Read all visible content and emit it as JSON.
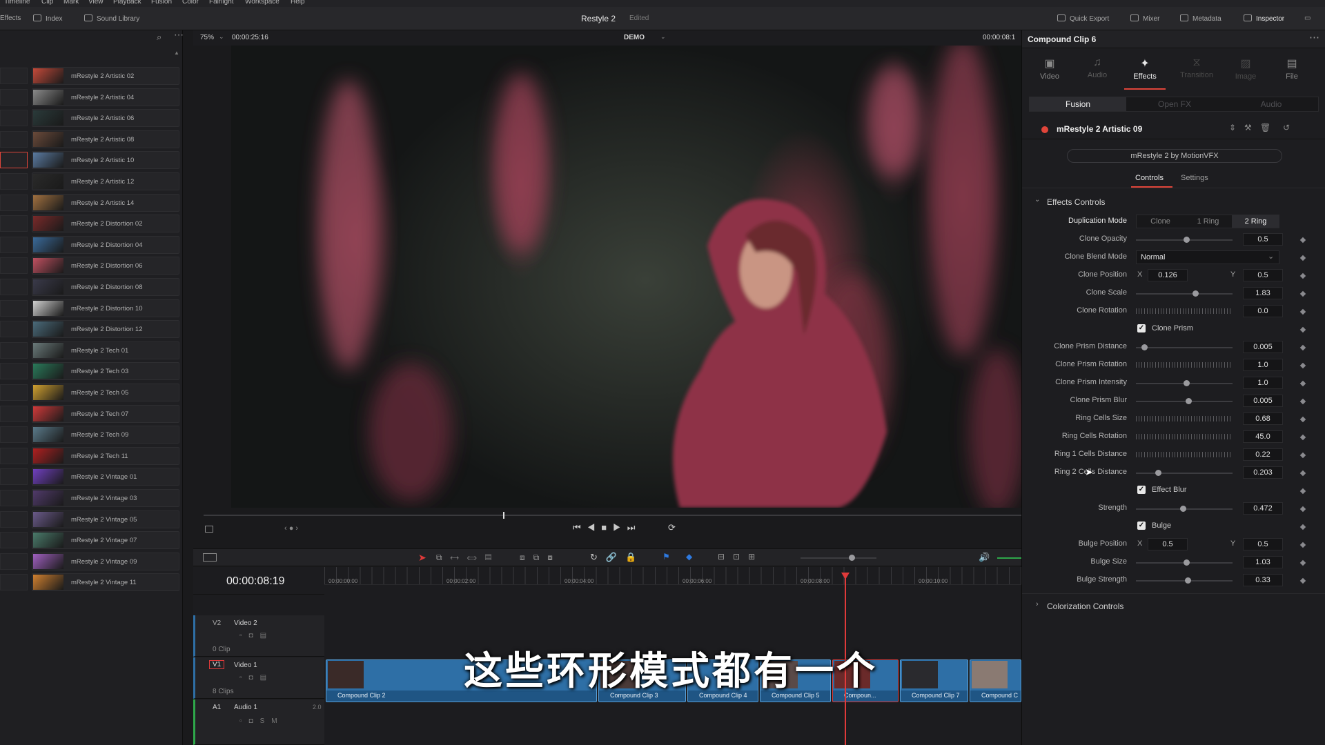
{
  "menu": [
    "Timeline",
    "Clip",
    "Mark",
    "View",
    "Playback",
    "Fusion",
    "Color",
    "Fairlight",
    "Workspace",
    "Help"
  ],
  "toolbar": {
    "effects": "Effects",
    "index": "Index",
    "sound_library": "Sound Library",
    "project_title": "Restyle 2",
    "project_status": "Edited",
    "quick_export": "Quick Export",
    "mixer": "Mixer",
    "metadata": "Metadata",
    "inspector": "Inspector"
  },
  "effects_list": [
    {
      "name": "mRestyle 2 Artistic 02",
      "color": "#c44a3a"
    },
    {
      "name": "mRestyle 2 Artistic 04",
      "color": "#8a8a8a"
    },
    {
      "name": "mRestyle 2 Artistic 06",
      "color": "#2a3a3a"
    },
    {
      "name": "mRestyle 2 Artistic 08",
      "color": "#6a4a3a"
    },
    {
      "name": "mRestyle 2 Artistic 10",
      "color": "#5a7aa0"
    },
    {
      "name": "mRestyle 2 Artistic 12",
      "color": "#2a2a2a"
    },
    {
      "name": "mRestyle 2 Artistic 14",
      "color": "#a07040"
    },
    {
      "name": "mRestyle 2 Distortion 02",
      "color": "#7a2a2a"
    },
    {
      "name": "mRestyle 2 Distortion 04",
      "color": "#3a6a9a"
    },
    {
      "name": "mRestyle 2 Distortion 06",
      "color": "#c05060"
    },
    {
      "name": "mRestyle 2 Distortion 08",
      "color": "#3a3a4a"
    },
    {
      "name": "mRestyle 2 Distortion 10",
      "color": "#d0d0d0"
    },
    {
      "name": "mRestyle 2 Distortion 12",
      "color": "#4a6a7a"
    },
    {
      "name": "mRestyle 2 Tech 01",
      "color": "#6a7a7a"
    },
    {
      "name": "mRestyle 2 Tech 03",
      "color": "#2a7a5a"
    },
    {
      "name": "mRestyle 2 Tech 05",
      "color": "#d0a030"
    },
    {
      "name": "mRestyle 2 Tech 07",
      "color": "#d03a3a"
    },
    {
      "name": "mRestyle 2 Tech 09",
      "color": "#5a7a8a"
    },
    {
      "name": "mRestyle 2 Tech 11",
      "color": "#b02020"
    },
    {
      "name": "mRestyle 2 Vintage 01",
      "color": "#7040c0"
    },
    {
      "name": "mRestyle 2 Vintage 03",
      "color": "#503a6a"
    },
    {
      "name": "mRestyle 2 Vintage 05",
      "color": "#6a5a8a"
    },
    {
      "name": "mRestyle 2 Vintage 07",
      "color": "#4a7a6a"
    },
    {
      "name": "mRestyle 2 Vintage 09",
      "color": "#a060c0"
    },
    {
      "name": "mRestyle 2 Vintage 11",
      "color": "#d08030"
    }
  ],
  "viewer": {
    "zoom": "75%",
    "timecode": "00:00:25:16",
    "clip_name": "DEMO",
    "right_timecode": "00:00:08:1"
  },
  "timeline": {
    "current_timecode": "00:00:08:19",
    "ruler": [
      "00:00:00:00",
      "00:00:02:00",
      "00:00:04:00",
      "00:00:06:00",
      "00:00:08:00",
      "00:00:10:00"
    ],
    "tracks": {
      "v2": {
        "id": "V2",
        "name": "Video 2",
        "count": "0 Clip"
      },
      "v1": {
        "id": "V1",
        "name": "Video 1",
        "count": "8 Clips"
      },
      "a1": {
        "id": "A1",
        "name": "Audio 1",
        "level": "2.0"
      }
    },
    "clips": [
      "Compound Clip 2",
      "Compound Clip 3",
      "Compound Clip 4",
      "Compound Clip 5",
      "Compoun...",
      "Compound Clip 7",
      "Compound C"
    ],
    "subtitle": "这些环形模式都有一个"
  },
  "inspector": {
    "title": "Compound Clip 6",
    "tabs": [
      "Video",
      "Audio",
      "Effects",
      "Transition",
      "Image",
      "File"
    ],
    "subtabs": [
      "Fusion",
      "Open FX",
      "Audio"
    ],
    "effect_name": "mRestyle 2 Artistic 09",
    "plugin_button": "mRestyle 2 by MotionVFX",
    "control_tabs": [
      "Controls",
      "Settings"
    ],
    "section_effects": "Effects Controls",
    "section_colorization": "Colorization Controls",
    "duplication_mode": {
      "label": "Duplication Mode",
      "options": [
        "Clone",
        "1 Ring",
        "2 Ring"
      ]
    },
    "clone_blend_mode": {
      "label": "Clone Blend Mode",
      "value": "Normal"
    },
    "clone_position": {
      "label": "Clone Position",
      "x_label": "X",
      "x": "0.126",
      "y_label": "Y",
      "y": "0.5"
    },
    "bulge_position": {
      "label": "Bulge Position",
      "x_label": "X",
      "x": "0.5",
      "y_label": "Y",
      "y": "0.5"
    },
    "checks": {
      "clone_prism": "Clone Prism",
      "effect_blur": "Effect Blur",
      "bulge": "Bulge"
    },
    "params": {
      "clone_opacity": {
        "label": "Clone Opacity",
        "value": "0.5"
      },
      "clone_scale": {
        "label": "Clone Scale",
        "value": "1.83"
      },
      "clone_rotation": {
        "label": "Clone Rotation",
        "value": "0.0"
      },
      "clone_prism_distance": {
        "label": "Clone Prism Distance",
        "value": "0.005"
      },
      "clone_prism_rotation": {
        "label": "Clone Prism Rotation",
        "value": "1.0"
      },
      "clone_prism_intensity": {
        "label": "Clone Prism Intensity",
        "value": "1.0"
      },
      "clone_prism_blur": {
        "label": "Clone Prism Blur",
        "value": "0.005"
      },
      "ring_cells_size": {
        "label": "Ring Cells Size",
        "value": "0.68"
      },
      "ring_cells_rotation": {
        "label": "Ring Cells Rotation",
        "value": "45.0"
      },
      "ring1_cells_distance": {
        "label": "Ring 1 Cells Distance",
        "value": "0.22"
      },
      "ring2_cells_distance": {
        "label": "Ring 2 Cells Distance",
        "value": "0.203"
      },
      "strength": {
        "label": "Strength",
        "value": "0.472"
      },
      "bulge_size": {
        "label": "Bulge Size",
        "value": "1.03"
      },
      "bulge_strength": {
        "label": "Bulge Strength",
        "value": "0.33"
      }
    }
  },
  "colors": {
    "accent": "#e0453a",
    "clip_blue": "#2e6fa6",
    "playhead": "#e03a3a"
  }
}
